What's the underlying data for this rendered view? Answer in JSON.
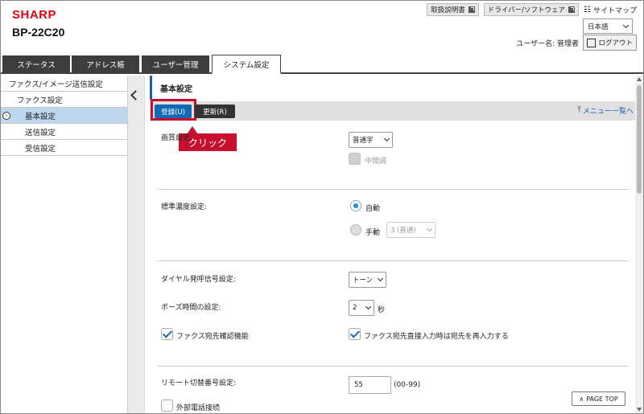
{
  "header": {
    "logo": "SHARP",
    "model": "BP-22C20",
    "links": {
      "manual": "取扱説明書",
      "driver": "ドライバー/ソフトウェア",
      "sitemap": "サイトマップ"
    },
    "language": "日本語",
    "username": "ユーザー名: 管理者",
    "logout": "ログアウト"
  },
  "tabs": [
    "ステータス",
    "アドレス帳",
    "ユーザー管理",
    "システム設定"
  ],
  "sidebar": {
    "items": [
      {
        "label": "ファクス/イメージ送信設定"
      },
      {
        "label": "ファクス設定"
      },
      {
        "label": "基本設定"
      },
      {
        "label": "送信設定"
      },
      {
        "label": "受信設定"
      }
    ]
  },
  "main": {
    "title": "基本設定",
    "register_button": "登録(U)",
    "update_button": "更新(R)",
    "menu_link": "メニュー一覧へ",
    "callout": "クリック",
    "image_quality": {
      "label": "画質設定:",
      "value": "普通字",
      "halftone_label": "中間調"
    },
    "density": {
      "label": "標準濃度設定:",
      "auto_label": "自動",
      "manual_label": "手動",
      "manual_value": "3 (普通)"
    },
    "dial": {
      "label": "ダイヤル発呼信号設定:",
      "value": "トーン"
    },
    "pause": {
      "label": "ポーズ時間の設定:",
      "value": "2",
      "unit": "秒"
    },
    "confirm_dest": {
      "label": "ファクス宛先確認機能"
    },
    "reenter_dest": {
      "label": "ファクス宛先直接入力時は宛先を再入力する"
    },
    "remote": {
      "label": "リモート切替番号設定:",
      "value": "55",
      "range": "(00-99)"
    },
    "external_phone": {
      "label": "外部電話接続"
    },
    "page_top": "PAGE TOP"
  },
  "colors": {
    "brand": "#e60012",
    "accent": "#1469b4",
    "callout": "#c8102e"
  }
}
